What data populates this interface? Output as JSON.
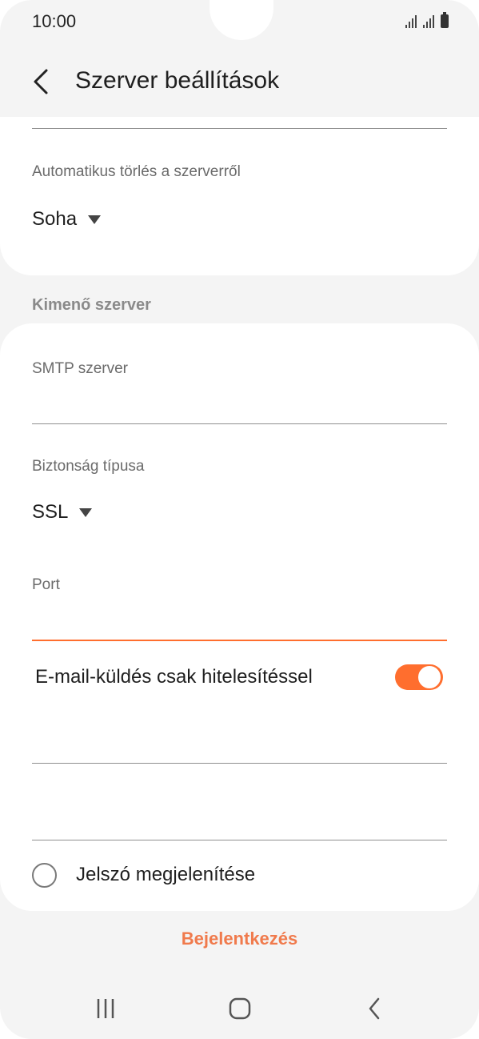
{
  "status_bar": {
    "time": "10:00"
  },
  "header": {
    "title": "Szerver beállítások"
  },
  "top_card": {
    "delete_label": "Automatikus törlés a szerverről",
    "delete_value": "Soha"
  },
  "outgoing": {
    "section_title": "Kimenő szerver",
    "smtp_label": "SMTP szerver",
    "smtp_value": "",
    "security_label": "Biztonság típusa",
    "security_value": "SSL",
    "port_label": "Port",
    "port_value": "",
    "auth_label": "E-mail-küldés csak hitelesítéssel",
    "auth_enabled": true,
    "show_password_label": "Jelszó megjelenítése"
  },
  "actions": {
    "login_label": "Bejelentkezés"
  },
  "colors": {
    "accent": "#ff6e2e",
    "login_text": "#f07a4c"
  },
  "icons": {
    "back": "chevron-left-icon",
    "recents": "recent-apps-icon",
    "home": "home-icon",
    "nav_back": "nav-back-icon"
  }
}
